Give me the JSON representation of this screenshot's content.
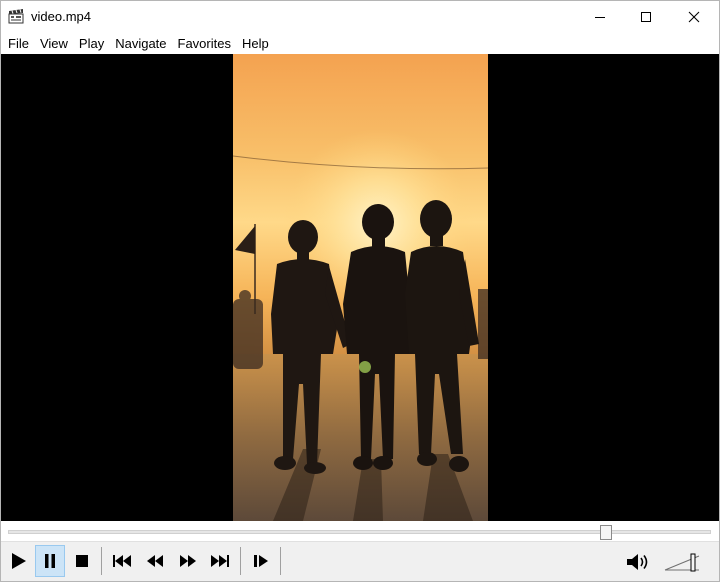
{
  "window": {
    "title": "video.mp4"
  },
  "menu": [
    "File",
    "View",
    "Play",
    "Navigate",
    "Favorites",
    "Help"
  ],
  "playback": {
    "state": "paused",
    "seek_position_fraction": 0.85,
    "volume_fraction": 0.75
  },
  "controls": [
    "play",
    "pause",
    "stop",
    "previous",
    "rewind",
    "fast-forward",
    "next",
    "frame-step"
  ],
  "icons": {
    "app": "film-clapper-icon",
    "minimize": "minimize-icon",
    "maximize": "maximize-icon",
    "close": "close-icon",
    "volume": "speaker-icon"
  },
  "colors": {
    "active_button_bg": "#cce4f7",
    "video_bg": "#000000"
  }
}
